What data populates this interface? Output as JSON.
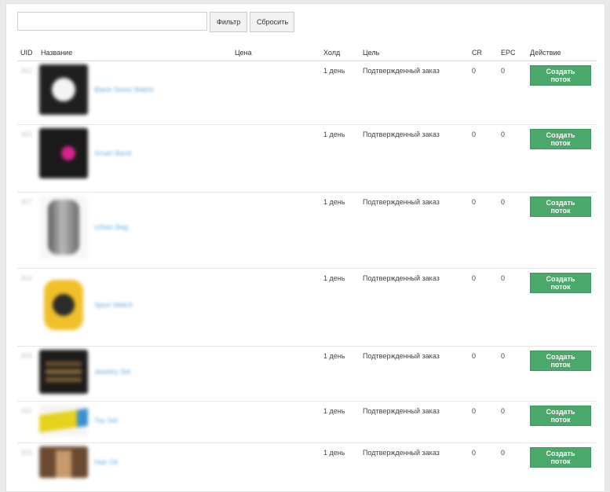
{
  "filter": {
    "search_placeholder": "",
    "filter_label": "Фильтр",
    "reset_label": "Сбросить"
  },
  "table": {
    "headers": {
      "uid": "UID",
      "name": "Название",
      "price": "Цена",
      "hold": "Холд",
      "goal": "Цель",
      "cr": "CR",
      "epc": "EPC",
      "action": "Действие"
    },
    "rows": [
      {
        "uid": "362",
        "name": "Black Swiss Watch",
        "hold": "1 день",
        "goal": "Подтвержденный заказ",
        "cr": "0",
        "epc": "0",
        "action": "Создать поток"
      },
      {
        "uid": "365",
        "name": "Smart Band",
        "hold": "1 день",
        "goal": "Подтвержденный заказ",
        "cr": "0",
        "epc": "0",
        "action": "Создать поток"
      },
      {
        "uid": "357",
        "name": "Urban Bag",
        "hold": "1 день",
        "goal": "Подтвержденный заказ",
        "cr": "0",
        "epc": "0",
        "action": "Создать поток"
      },
      {
        "uid": "364",
        "name": "Sport Watch",
        "hold": "1 день",
        "goal": "Подтвержденный заказ",
        "cr": "0",
        "epc": "0",
        "action": "Создать поток"
      },
      {
        "uid": "359",
        "name": "Jewelry Set",
        "hold": "1 день",
        "goal": "Подтвержденный заказ",
        "cr": "0",
        "epc": "0",
        "action": "Создать поток"
      },
      {
        "uid": "352",
        "name": "Toy Set",
        "hold": "1 день",
        "goal": "Подтвержденный заказ",
        "cr": "0",
        "epc": "0",
        "action": "Создать поток"
      },
      {
        "uid": "355",
        "name": "Hair Oil",
        "hold": "1 день",
        "goal": "Подтвержденный заказ",
        "cr": "0",
        "epc": "0",
        "action": "Создать поток"
      }
    ]
  },
  "thumbnail_icons": [
    "watch-thumbnail",
    "band-thumbnail",
    "bag-thumbnail",
    "watch-thumbnail",
    "jewelry-thumbnail",
    "toy-thumbnail",
    "product-thumbnail"
  ],
  "colors": {
    "create_button": "#4aa86a",
    "product_link": "#6aaedf"
  }
}
